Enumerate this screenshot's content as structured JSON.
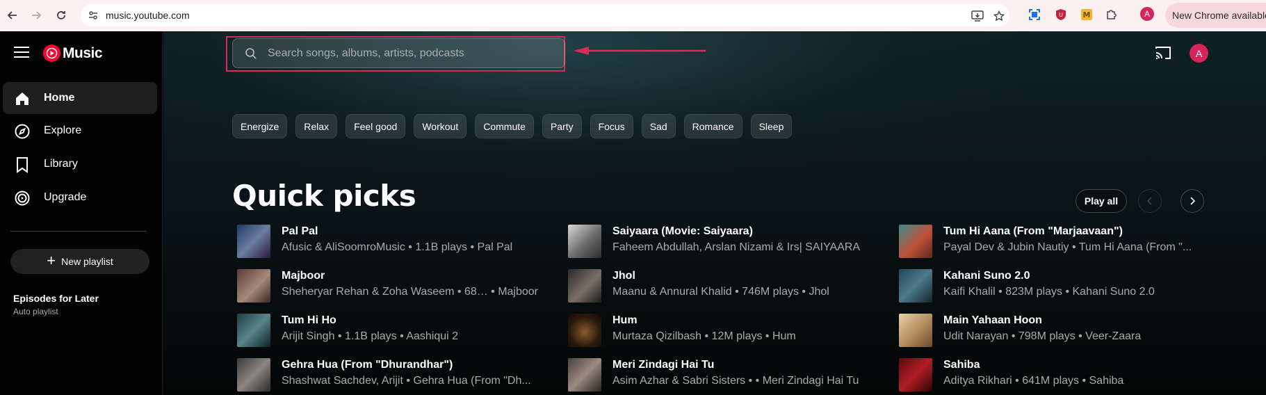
{
  "browser": {
    "url": "music.youtube.com",
    "update_label": "New Chrome available",
    "profile_initial": "A"
  },
  "sidebar": {
    "logo_text": "Music",
    "items": [
      {
        "label": "Home",
        "icon": "home-icon",
        "active": true
      },
      {
        "label": "Explore",
        "icon": "compass-icon"
      },
      {
        "label": "Library",
        "icon": "bookmark-icon"
      },
      {
        "label": "Upgrade",
        "icon": "upgrade-icon"
      }
    ],
    "new_playlist_label": "New playlist",
    "playlist": {
      "title": "Episodes for Later",
      "subtitle": "Auto playlist"
    }
  },
  "header": {
    "search_placeholder": "Search songs, albums, artists, podcasts",
    "avatar_initial": "A"
  },
  "chips": [
    "Energize",
    "Relax",
    "Feel good",
    "Workout",
    "Commute",
    "Party",
    "Focus",
    "Sad",
    "Romance",
    "Sleep"
  ],
  "quick_picks": {
    "title": "Quick picks",
    "play_all_label": "Play all",
    "columns": [
      [
        {
          "title": "Pal Pal",
          "subtitle": "Afusic & AliSoomroMusic • 1.1B plays • Pal Pal"
        },
        {
          "title": "Majboor",
          "subtitle": "Sheheryar Rehan & Zoha Waseem • 68… • Majboor"
        },
        {
          "title": "Tum Hi Ho",
          "subtitle": "Arijit Singh • 1.1B plays • Aashiqui 2"
        },
        {
          "title": "Gehra Hua (From \"Dhurandhar\")",
          "subtitle": "Shashwat Sachdev, Arijit  • Gehra Hua (From \"Dh..."
        }
      ],
      [
        {
          "title": "Saiyaara (Movie: Saiyaara)",
          "subtitle": "Faheem Abdullah, Arslan Nizami & Irs| SAIYAARA"
        },
        {
          "title": "Jhol",
          "subtitle": "Maanu & Annural Khalid • 746M plays • Jhol"
        },
        {
          "title": "Hum",
          "subtitle": "Murtaza Qizilbash • 12M plays • Hum"
        },
        {
          "title": "Meri Zindagi Hai Tu",
          "subtitle": "Asim Azhar & Sabri Sisters •  • Meri Zindagi Hai Tu"
        }
      ],
      [
        {
          "title": "Tum Hi Aana (From \"Marjaavaan\")",
          "subtitle": "Payal Dev & Jubin Nautiy • Tum Hi Aana (From \"..."
        },
        {
          "title": "Kahani Suno 2.0",
          "subtitle": "Kaifi Khalil • 823M plays • Kahani Suno 2.0"
        },
        {
          "title": "Main Yahaan Hoon",
          "subtitle": "Udit Narayan • 798M plays • Veer-Zaara"
        },
        {
          "title": "Sahiba",
          "subtitle": "Aditya Rikhari • 641M plays • Sahiba"
        }
      ]
    ]
  },
  "colors": {
    "accent": "#ff0033",
    "annotation": "#d62c55"
  }
}
